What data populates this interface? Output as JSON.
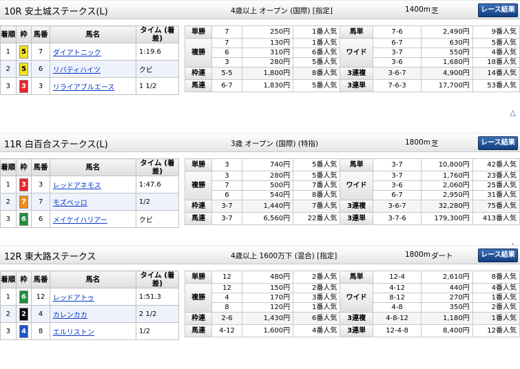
{
  "buttons": {
    "result": "レース結果"
  },
  "headers": {
    "rank": "着順",
    "waku": "枠",
    "num": "馬番",
    "name": "馬名",
    "time": "タイム (着差)"
  },
  "pay_labels": {
    "tansho": "単勝",
    "fukusho": "複勝",
    "wakuren": "枠連",
    "umaren": "馬連",
    "umatan": "馬単",
    "wide": "ワイド",
    "sanfuku": "3連複",
    "santan": "3連単"
  },
  "colors": {
    "waku1": "#ffffff",
    "waku2": "#000000",
    "waku3": "#e8252b",
    "waku4": "#1e54c9",
    "waku5": "#f5e21a",
    "waku6": "#1e8f3a",
    "waku7": "#f28a1f",
    "waku8": "#f38bb4",
    "link": "#0033cc",
    "button": "#1d4c8f"
  },
  "race1": {
    "title": "10R 安土城ステークス(L)",
    "cond": "4歳以上 オープン (国際) [指定]",
    "dist": "1400m",
    "surface": "芝",
    "results": [
      {
        "rank": "1",
        "waku": "5",
        "waku_color": "#f5e21a",
        "num": "7",
        "name": "ダイアトニック",
        "time": "1:19.6"
      },
      {
        "rank": "2",
        "waku": "5",
        "waku_color": "#f5e21a",
        "num": "6",
        "name": "リバティハイツ",
        "time": "クビ"
      },
      {
        "rank": "3",
        "waku": "3",
        "waku_color": "#e8252b",
        "num": "3",
        "name": "リライアブルエース",
        "time": "1 1/2"
      }
    ],
    "tansho": {
      "n": "7",
      "y": "250円",
      "p": "1番人気"
    },
    "fukusho": [
      {
        "n": "7",
        "y": "130円",
        "p": "1番人気"
      },
      {
        "n": "6",
        "y": "310円",
        "p": "6番人気"
      },
      {
        "n": "3",
        "y": "280円",
        "p": "5番人気"
      }
    ],
    "wakuren": {
      "n": "5-5",
      "y": "1,800円",
      "p": "8番人気"
    },
    "umaren": {
      "n": "6-7",
      "y": "1,830円",
      "p": "5番人気"
    },
    "umatan": {
      "n": "7-6",
      "y": "2,490円",
      "p": "9番人気"
    },
    "wide": [
      {
        "n": "6-7",
        "y": "630円",
        "p": "5番人気"
      },
      {
        "n": "3-7",
        "y": "550円",
        "p": "4番人気"
      },
      {
        "n": "3-6",
        "y": "1,680円",
        "p": "18番人気"
      }
    ],
    "sanfuku": {
      "n": "3-6-7",
      "y": "4,900円",
      "p": "14番人気"
    },
    "santan": {
      "n": "7-6-3",
      "y": "17,700円",
      "p": "53番人気"
    }
  },
  "race2": {
    "title": "11R 白百合ステークス(L)",
    "cond": "3歳 オープン (国際) (特指)",
    "dist": "1800m",
    "surface": "芝",
    "results": [
      {
        "rank": "1",
        "waku": "3",
        "waku_color": "#e8252b",
        "num": "3",
        "name": "レッドアネモス",
        "time": "1:47.6"
      },
      {
        "rank": "2",
        "waku": "7",
        "waku_color": "#f28a1f",
        "num": "7",
        "name": "モズベッロ",
        "time": "1/2"
      },
      {
        "rank": "3",
        "waku": "6",
        "waku_color": "#1e8f3a",
        "num": "6",
        "name": "メイケイハリアー",
        "time": "クビ"
      }
    ],
    "tansho": {
      "n": "3",
      "y": "740円",
      "p": "5番人気"
    },
    "fukusho": [
      {
        "n": "3",
        "y": "280円",
        "p": "5番人気"
      },
      {
        "n": "7",
        "y": "500円",
        "p": "7番人気"
      },
      {
        "n": "6",
        "y": "540円",
        "p": "8番人気"
      }
    ],
    "wakuren": {
      "n": "3-7",
      "y": "1,440円",
      "p": "7番人気"
    },
    "umaren": {
      "n": "3-7",
      "y": "6,560円",
      "p": "22番人気"
    },
    "umatan": {
      "n": "3-7",
      "y": "10,800円",
      "p": "42番人気"
    },
    "wide": [
      {
        "n": "3-7",
        "y": "1,760円",
        "p": "23番人気"
      },
      {
        "n": "3-6",
        "y": "2,060円",
        "p": "25番人気"
      },
      {
        "n": "6-7",
        "y": "2,950円",
        "p": "31番人気"
      }
    ],
    "sanfuku": {
      "n": "3-6-7",
      "y": "32,280円",
      "p": "75番人気"
    },
    "santan": {
      "n": "3-7-6",
      "y": "179,300円",
      "p": "413番人気"
    }
  },
  "race3": {
    "title": "12R 東大路ステークス",
    "cond": "4歳以上 1600万下 (混合) [指定]",
    "dist": "1800m",
    "surface": "ダート",
    "results": [
      {
        "rank": "1",
        "waku": "6",
        "waku_color": "#1e8f3a",
        "num": "12",
        "name": "レッドアトゥ",
        "time": "1:51.3"
      },
      {
        "rank": "2",
        "waku": "2",
        "waku_color": "#000000",
        "num": "4",
        "name": "カレンカカ",
        "time": "2 1/2"
      },
      {
        "rank": "3",
        "waku": "4",
        "waku_color": "#1e54c9",
        "num": "8",
        "name": "エルリストン",
        "time": "1/2"
      }
    ],
    "tansho": {
      "n": "12",
      "y": "480円",
      "p": "2番人気"
    },
    "fukusho": [
      {
        "n": "12",
        "y": "150円",
        "p": "2番人気"
      },
      {
        "n": "4",
        "y": "170円",
        "p": "3番人気"
      },
      {
        "n": "8",
        "y": "120円",
        "p": "1番人気"
      }
    ],
    "wakuren": {
      "n": "2-6",
      "y": "1,430円",
      "p": "6番人気"
    },
    "umaren": {
      "n": "4-12",
      "y": "1,600円",
      "p": "4番人気"
    },
    "umatan": {
      "n": "12-4",
      "y": "2,610円",
      "p": "8番人気"
    },
    "wide": [
      {
        "n": "4-12",
        "y": "440円",
        "p": "4番人気"
      },
      {
        "n": "8-12",
        "y": "270円",
        "p": "1番人気"
      },
      {
        "n": "4-8",
        "y": "350円",
        "p": "2番人気"
      }
    ],
    "sanfuku": {
      "n": "4-8-12",
      "y": "1,180円",
      "p": "1番人気"
    },
    "santan": {
      "n": "12-4-8",
      "y": "8,400円",
      "p": "12番人気"
    }
  }
}
